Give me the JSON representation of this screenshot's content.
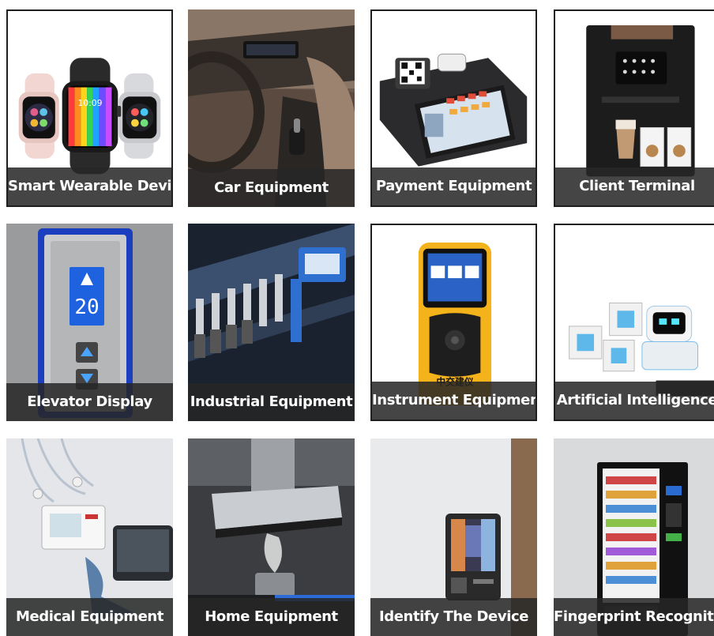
{
  "tiles": [
    {
      "label": "Smart Wearable Device",
      "icon": "smartwatch-icon"
    },
    {
      "label": "Car Equipment",
      "icon": "car-interior-icon"
    },
    {
      "label": "Payment Equipment",
      "icon": "pos-terminal-icon"
    },
    {
      "label": "Client Terminal",
      "icon": "coffee-machine-icon"
    },
    {
      "label": "Elevator Display",
      "icon": "elevator-panel-icon"
    },
    {
      "label": "Industrial Equipment",
      "icon": "industrial-machine-icon"
    },
    {
      "label": "Instrument Equipment",
      "icon": "handheld-instrument-icon"
    },
    {
      "label": "Artificial Intelligence",
      "icon": "robot-icon"
    },
    {
      "label": "Medical Equipment",
      "icon": "medical-device-icon"
    },
    {
      "label": "Home Equipment",
      "icon": "range-hood-icon"
    },
    {
      "label": "Identify The Device",
      "icon": "face-recognition-terminal-icon"
    },
    {
      "label": "Fingerprint Recognition",
      "icon": "vending-machine-icon"
    }
  ],
  "device_text": {
    "watch_time": "10:09",
    "elevator_floor": "20",
    "instrument_brand": "中交建仪"
  }
}
